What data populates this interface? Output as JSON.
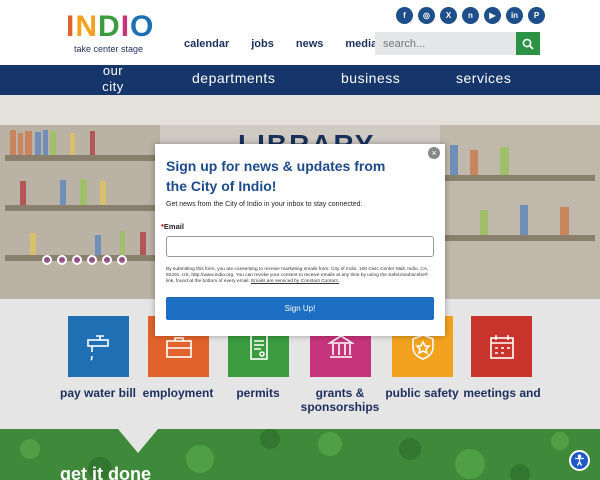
{
  "header": {
    "logo": {
      "letters": [
        "I",
        "N",
        "D",
        "I",
        "O"
      ],
      "tagline": "take center stage"
    },
    "top_links": [
      "calendar",
      "jobs",
      "news",
      "media"
    ],
    "social_icons": [
      "facebook-icon",
      "instagram-icon",
      "x-icon",
      "nextdoor-icon",
      "youtube-icon",
      "linkedin-icon",
      "pinterest-icon"
    ],
    "search": {
      "placeholder": "search..."
    }
  },
  "main_nav": {
    "our_city": "our city",
    "departments": "departments",
    "business": "business",
    "services": "services"
  },
  "hero": {
    "sign_text": "LIBRARY",
    "slide_count": 6
  },
  "tiles": [
    {
      "label": "pay water bill",
      "color": "#1f6fb5",
      "icon": "faucet-icon"
    },
    {
      "label": "employment",
      "color": "#e2622b",
      "icon": "briefcase-icon"
    },
    {
      "label": "permits",
      "color": "#3a9b3f",
      "icon": "document-icon"
    },
    {
      "label": "grants & sponsorships",
      "color": "#c5337b",
      "icon": "grant-icon"
    },
    {
      "label": "public safety",
      "color": "#f2a21e",
      "icon": "badge-icon"
    },
    {
      "label": "meetings and",
      "color": "#c8342c",
      "icon": "calendar-icon"
    }
  ],
  "footer_band": {
    "heading": "get it done"
  },
  "modal": {
    "title": "Sign up for news & updates from the City of Indio!",
    "subtitle": "Get news from the City of Indio in your inbox to stay connected.",
    "email_label": "Email",
    "required_mark": "*",
    "fine_print": "By submitting this form, you are consenting to receive marketing emails from: City of Indio, 100 Civic Center Mall, Indio, CA, 92201, US, http://www.indio.org. You can revoke your consent to receive emails at any time by using the SafeUnsubscribe® link, found at the bottom of every email.",
    "fine_print_link": "Emails are serviced by Constant Contact.",
    "button": "Sign Up!",
    "close": "×"
  },
  "colors": {
    "navy": "#15356b",
    "green": "#3f8a3a",
    "modal_blue": "#1b6ec2"
  }
}
